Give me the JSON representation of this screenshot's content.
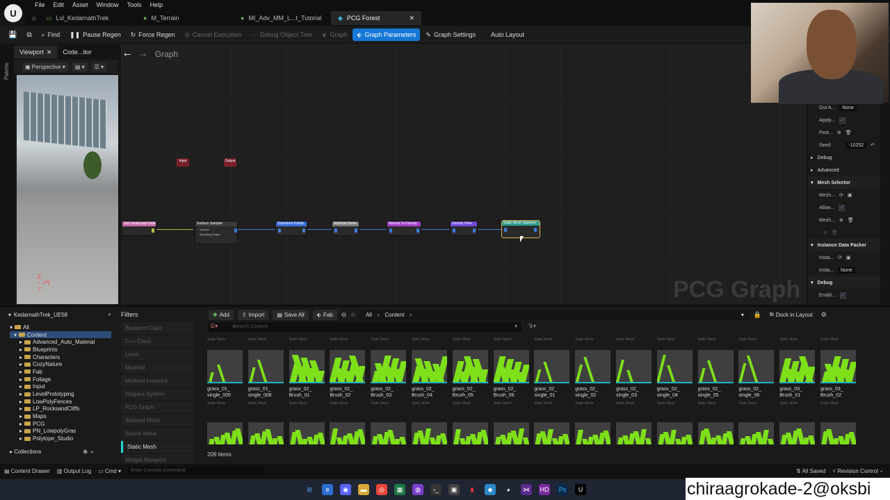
{
  "menu": [
    "File",
    "Edit",
    "Asset",
    "Window",
    "Tools",
    "Help"
  ],
  "tabs": [
    {
      "label": "Lvl_KedarnathTrek",
      "icon": "level-icon",
      "active": false
    },
    {
      "label": "M_Terrain",
      "icon": "material-icon",
      "active": false
    },
    {
      "label": "MI_Adv_MM_L...t_Tutorial",
      "icon": "material-instance-icon",
      "active": false
    },
    {
      "label": "PCG Forest",
      "icon": "pcg-icon",
      "active": true
    }
  ],
  "toolbar": {
    "find": "Find",
    "pause": "Pause Regen",
    "force": "Force Regen",
    "cancel": "Cancel Execution",
    "debug_tree": "Debug Object Tree",
    "graph": "Graph",
    "graph_params": "Graph Parameters",
    "graph_settings": "Graph Settings",
    "auto_layout": "Auto Layout"
  },
  "palette": "Palette",
  "viewport_tabs": {
    "viewport": "Viewport",
    "code": "Code...itor"
  },
  "viewport": {
    "perspective": "Perspective"
  },
  "graph": {
    "title": "Graph",
    "watermark": "PCG Graph",
    "input": "Input",
    "output": "Output"
  },
  "nodes": [
    {
      "label": "Get Landscape Data",
      "color": "#c16aa6"
    },
    {
      "label": "Surface Sampler",
      "color": "#3a3a3a",
      "rows": [
        "Surface",
        "Bounding Shape"
      ]
    },
    {
      "label": "Transform Points",
      "color": "#3a6ed8"
    },
    {
      "label": "Attribute Noise",
      "color": "#7b7b7b"
    },
    {
      "label": "Normal To Density",
      "color": "#a340c8"
    },
    {
      "label": "Density Filter",
      "color": "#6e48d8"
    },
    {
      "label": "Static Mesh Spawner",
      "color": "#2f9e8a"
    }
  ],
  "details": {
    "rows": [
      {
        "label": "Out A...",
        "value": "None",
        "kind": "text"
      },
      {
        "label": "Apply...",
        "kind": "check"
      },
      {
        "label": "Post...",
        "kind": "plus"
      },
      {
        "label": "Seed",
        "value": "-10252",
        "kind": "text"
      },
      {
        "label": "Debug",
        "kind": "collapsed"
      },
      {
        "label": "Advanced",
        "kind": "collapsed"
      },
      {
        "label": "Mesh Selector",
        "kind": "section"
      },
      {
        "label": "Mesh...",
        "kind": "icons"
      },
      {
        "label": "Allow...",
        "kind": "check"
      },
      {
        "label": "Mesh...",
        "kind": "plus"
      },
      {
        "label": "",
        "kind": "dim"
      },
      {
        "label": "Instance Data Packer",
        "kind": "section"
      },
      {
        "label": "Insta...",
        "kind": "icons"
      },
      {
        "label": "Insta...",
        "value": "None",
        "kind": "text"
      },
      {
        "label": "Debug",
        "kind": "section"
      },
      {
        "label": "Enabl...",
        "kind": "check"
      }
    ]
  },
  "content_browser": {
    "project": "KedarnathTrek_UE58",
    "tree": [
      "All",
      "Content",
      "Advanced_Auto_Material",
      "Blueprints",
      "Characters",
      "CozyNature",
      "Fab",
      "Foliage",
      "Input",
      "LevelPrototyping",
      "LowPolyFences",
      "LP_RocksandCliffs",
      "Maps",
      "PCG",
      "PN_LowpolyGras",
      "Polytope_Studio"
    ],
    "collections": "Collections",
    "filters_title": "Filters",
    "filters": [
      "Blueprint Class",
      "C++ Class",
      "Level",
      "Material",
      "Material Instance",
      "Niagara System",
      "PCG Graph",
      "Skeletal Mesh",
      "Sound Wave",
      "Static Mesh",
      "Widget Blueprint"
    ],
    "active_filter": "Static Mesh",
    "buttons": {
      "add": "Add",
      "import": "Import",
      "save_all": "Save All",
      "fab": "Fab",
      "dock": "Dock in Layout"
    },
    "path": [
      "All",
      "Content"
    ],
    "search_placeholder": "Search Content",
    "asset_type": "Static Mesh",
    "assets": [
      "grass_01_\nsingle_005",
      "grass_01_\nsingle_006",
      "grass_02_\nBrush_01",
      "grass_02_\nBrush_02",
      "grass_02_\nBrush_03",
      "grass_02_\nBrush_04",
      "grass_02_\nBrush_05",
      "grass_02_\nBrush_06",
      "grass_02_\nsingle_01",
      "grass_02_\nsingle_02",
      "grass_02_\nsingle_03",
      "grass_02_\nsingle_04",
      "grass_02_\nsingle_05",
      "grass_02_\nsingle_06",
      "grass_03_\nBrush_01",
      "grass_03_\nBrush_02"
    ],
    "item_count": "209 items"
  },
  "statusbar": {
    "content_drawer": "Content Drawer",
    "output_log": "Output Log",
    "cmd": "Cmd",
    "console_placeholder": "Enter Console Command",
    "all_saved": "All Saved",
    "revision": "Revision Control"
  },
  "overlay_name": "chiraagrokade-2@oksbi",
  "colors": {
    "accent": "#1577d6",
    "filter_active": "#21d7d7",
    "grass": "#7ee019"
  }
}
